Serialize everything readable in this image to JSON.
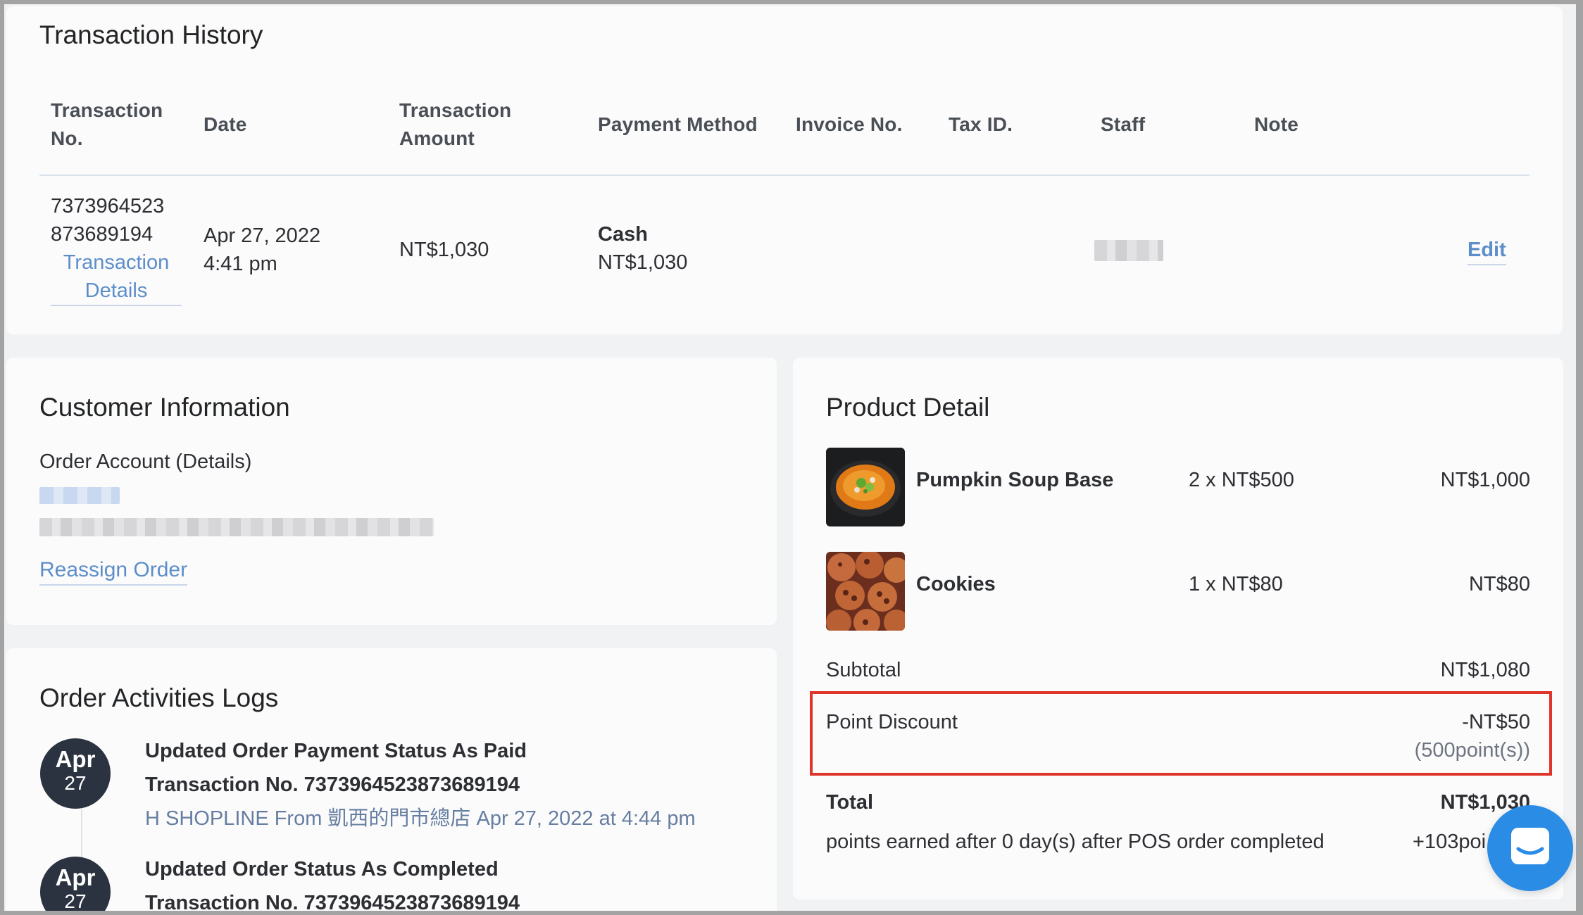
{
  "transaction_history": {
    "title": "Transaction History",
    "headers": {
      "txn_no": "Transaction No.",
      "date": "Date",
      "amount": "Transaction Amount",
      "payment": "Payment Method",
      "invoice": "Invoice No.",
      "tax": "Tax ID.",
      "staff": "Staff",
      "note": "Note"
    },
    "row": {
      "txn_no_line1": "7373964523",
      "txn_no_line2": "873689194",
      "details_link_1": "Transaction",
      "details_link_2": "Details",
      "date_line1": "Apr 27, 2022",
      "date_line2": "4:41 pm",
      "amount": "NT$1,030",
      "payment_method": "Cash",
      "payment_amount": "NT$1,030",
      "edit_label": "Edit"
    }
  },
  "customer_info": {
    "title": "Customer Information",
    "order_account_label": "Order Account (Details)",
    "reassign_label": "Reassign Order"
  },
  "order_logs": {
    "title": "Order Activities Logs",
    "entries": [
      {
        "month": "Apr",
        "day": "27",
        "title": "Updated Order Payment Status As Paid",
        "txn": "Transaction No. 7373964523873689194",
        "meta": "H SHOPLINE From 凱西的門市總店 Apr 27, 2022 at 4:44 pm"
      },
      {
        "month": "Apr",
        "day": "27",
        "title": "Updated Order Status As Completed",
        "txn": "Transaction No. 7373964523873689194"
      }
    ]
  },
  "product_detail": {
    "title": "Product Detail",
    "items": [
      {
        "name": "Pumpkin Soup Base",
        "qty_price": "2 x NT$500",
        "total": "NT$1,000"
      },
      {
        "name": "Cookies",
        "qty_price": "1 x NT$80",
        "total": "NT$80"
      }
    ],
    "subtotal_label": "Subtotal",
    "subtotal_value": "NT$1,080",
    "point_discount_label": "Point Discount",
    "point_discount_value": "-NT$50",
    "point_discount_points": "(500point(s))",
    "total_label": "Total",
    "total_value": "NT$1,030",
    "points_earned_label": "points earned after 0 day(s) after POS order completed",
    "points_earned_value": "+103poi"
  },
  "colors": {
    "link": "#5d8ec9",
    "highlight_border": "#e0342b",
    "chat_button": "#2a8ce5",
    "date_bubble": "#2b3340"
  },
  "icons": {
    "chat": "chat-bubble-icon"
  }
}
